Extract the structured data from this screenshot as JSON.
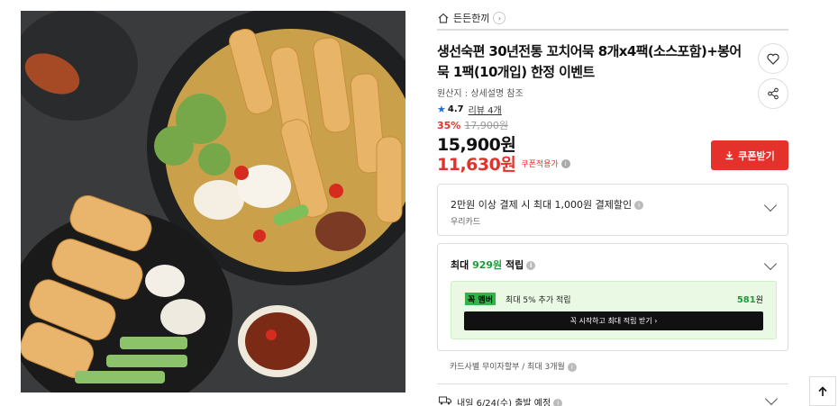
{
  "store": {
    "name": "든든한끼"
  },
  "product": {
    "title": "생선숙편 30년전통 꼬치어묵 8개x4팩(소스포함)+봉어묵 1팩(10개입) 한정 이벤트",
    "origin": "원산지 : 상세설명 참조",
    "rating": "4.7",
    "review_label": "리뷰 4개",
    "discount_pct": "35%",
    "original_price": "17,900원",
    "price": "15,900원",
    "coupon_price": "11,630원",
    "coupon_price_label": "쿠폰적용가"
  },
  "buttons": {
    "coupon": "쿠폰받기"
  },
  "card_promo": {
    "title": "2만원 이상 결제 시 최대 1,000원 결제할인",
    "sub": "우리카드"
  },
  "points": {
    "prefix": "최대 ",
    "amount": "929원",
    "suffix": " 적립",
    "badge": "꼭 멤버",
    "member_desc": "최대 5% 추가 적립",
    "member_value": "581",
    "member_unit": "원",
    "join_label": "꼭 시작하고 최대 적립 받기 ›"
  },
  "installment": "카드사별 무이자할부 / 최대 3개월",
  "shipping": {
    "label": "내일 6/24(수) 출발 예정"
  },
  "colors": {
    "accent_red": "#e4312b",
    "accent_green": "#1b9d3a"
  }
}
